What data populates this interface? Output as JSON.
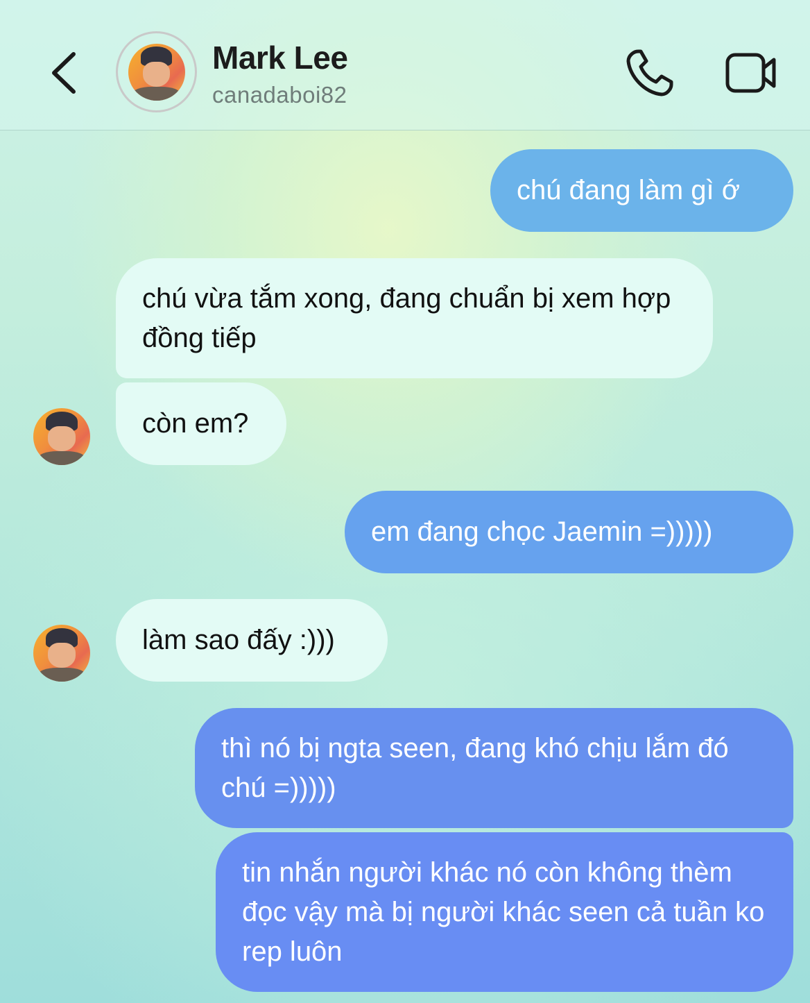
{
  "header": {
    "contact_name": "Mark Lee",
    "username": "canadaboi82",
    "icons": [
      "chevron-left-icon",
      "phone-icon",
      "video-camera-icon"
    ]
  },
  "messages": [
    {
      "sender": "me",
      "text": "chú đang làm gì ớ",
      "color": "#6bb3ea"
    },
    {
      "sender": "contact",
      "text": "chú vừa tắm xong, đang chuẩn bị xem hợp đồng tiếp"
    },
    {
      "sender": "contact",
      "text": "còn em?"
    },
    {
      "sender": "me",
      "text": "em đang chọc Jaemin =)))))",
      "color": "#66a2ee"
    },
    {
      "sender": "contact",
      "text": "làm sao đấy :)))"
    },
    {
      "sender": "me",
      "text": "thì nó bị ngta seen, đang khó chịu lắm đó chú =)))))",
      "color": "#6790ef"
    },
    {
      "sender": "me",
      "text": "tin nhắn người khác nó còn không thèm đọc vậy mà bị người khác seen cả tuần ko rep luôn",
      "color": "#688df3"
    }
  ]
}
